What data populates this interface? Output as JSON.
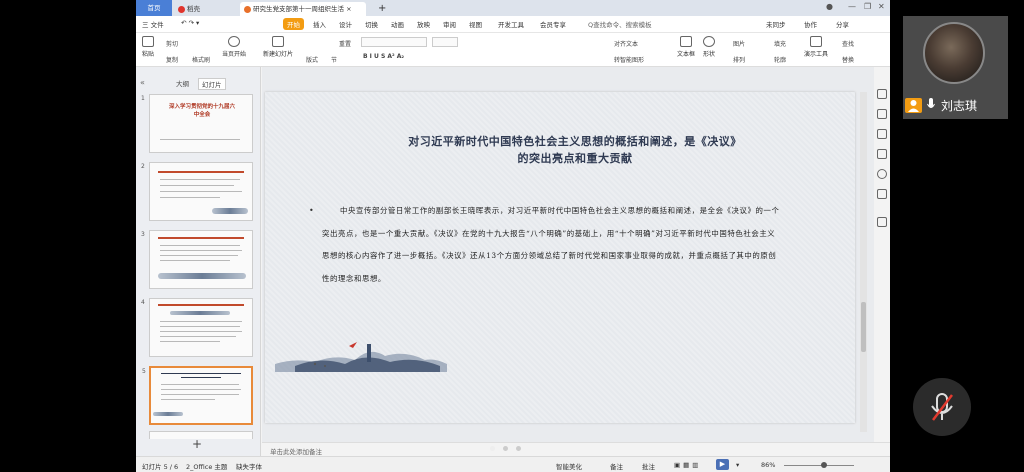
{
  "tabs": {
    "home": "首页",
    "daoke": "稻壳",
    "doc": "研究生党支部第十一周组织生活",
    "add": "+"
  },
  "menu": {
    "file": "三 文件",
    "start": "开始",
    "insert": "插入",
    "design": "设计",
    "switch": "切换",
    "animation": "动画",
    "slideshow": "放映",
    "review": "审阅",
    "view": "视图",
    "dev": "开发工具",
    "member": "会员专享",
    "search": "Q查找命令、搜索模板",
    "sync": "未同步",
    "collab": "协作",
    "share": "分享"
  },
  "ribbon": {
    "paste": "粘贴",
    "cut": "剪切",
    "copy": "复制",
    "format_painter": "格式刷",
    "from_start": "当页开始",
    "new_slide": "新建幻灯片",
    "layout": "版式",
    "section": "节",
    "reset": "重置",
    "text_box": "文本框",
    "shape": "形状",
    "arrange": "排列",
    "picture": "图片",
    "fill": "填充",
    "find": "查找",
    "replace": "替换",
    "select": "选择",
    "show_tools": "演示工具",
    "outline": "轮廓",
    "text_direction": "文字方向",
    "align_text": "对齐文本",
    "convert": "转智能图形"
  },
  "left_panel": {
    "tab_outline": "大纲",
    "tab_slides": "幻灯片",
    "thumb_numbers": [
      "1",
      "2",
      "3",
      "4",
      "5"
    ],
    "thumb1_title": "深入学习贯彻党的十九届六中全会",
    "add": "+"
  },
  "slide": {
    "title_line1": "对习近平新时代中国特色社会主义思想的概括和阐述，是《决议》",
    "title_line2": "的突出亮点和重大贡献",
    "bullet": "•",
    "body": "中央宣传部分管日常工作的副部长王晓晖表示，对习近平新时代中国特色社会主义思想的概括和阐述，是全会《决议》的一个突出亮点，也是一个重大贡献。《决议》在党的十九大报告“八个明确”的基础上，用“十个明确”对习近平新时代中国特色社会主义思想的核心内容作了进一步概括。《决议》还从13个方面分领域总结了新时代党和国家事业取得的成就，并重点概括了其中的原创性的理念和思想。"
  },
  "notes": "单击此处添加备注",
  "status": {
    "slide_count": "幻灯片 5 / 6",
    "theme": "2_Office 主题",
    "font": "缺失字体",
    "smart_beautify": "智能美化",
    "notes_btn": "备注",
    "comment_btn": "批注",
    "zoom": "86%"
  },
  "video": {
    "name": "刘志琪"
  }
}
